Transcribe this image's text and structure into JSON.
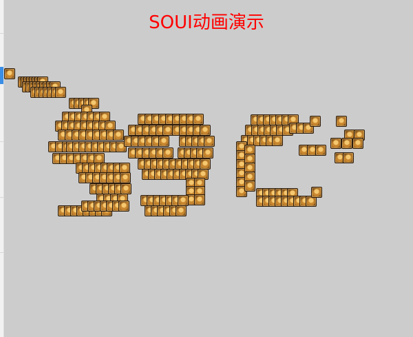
{
  "window": {
    "title": "SOUI动画演示",
    "title_color": "#ff0000",
    "background_color": "#cccccc"
  },
  "animation": {
    "sprite_icon": "lion-head-icon"
  }
}
